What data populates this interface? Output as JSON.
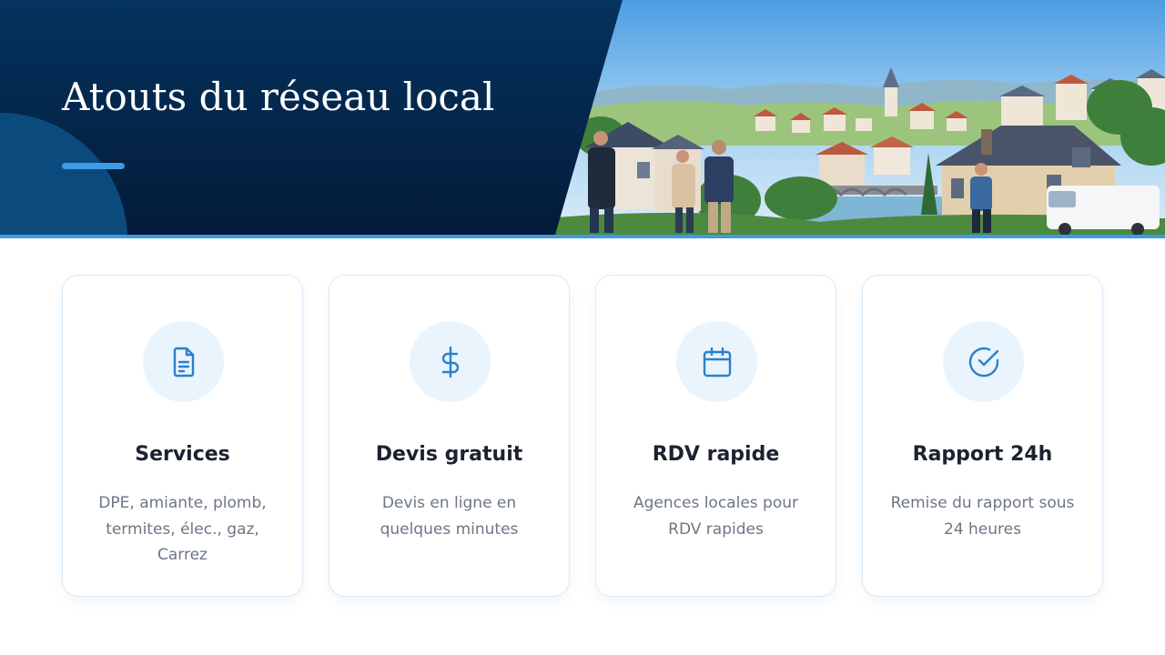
{
  "header": {
    "title": "Atouts du réseau local",
    "illustration": "local-town-scene-illustration"
  },
  "colors": {
    "navy": "#05264a",
    "navy_light": "#0a4a7c",
    "accent": "#3f9be3",
    "icon_blue": "#2c80c9",
    "icon_circle_bg": "#eaf4fd",
    "card_border": "#dbe9f7",
    "title_text": "#1b2330",
    "body_text": "#6c7686"
  },
  "cards": [
    {
      "icon": "document-icon",
      "title": "Services",
      "description": "DPE, amiante, plomb, termites, élec., gaz, Carrez"
    },
    {
      "icon": "dollar-icon",
      "title": "Devis gratuit",
      "description": "Devis en ligne en quelques minutes"
    },
    {
      "icon": "calendar-icon",
      "title": "RDV rapide",
      "description": "Agences locales pour RDV rapides"
    },
    {
      "icon": "check-circle-icon",
      "title": "Rapport 24h",
      "description": "Remise du rapport sous 24 heures"
    }
  ]
}
